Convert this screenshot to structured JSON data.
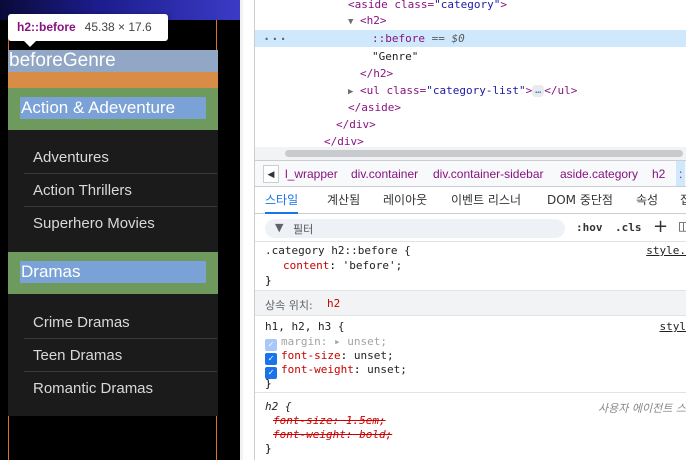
{
  "preview": {
    "before_text": "beforeGenre",
    "categories": [
      {
        "label": "Action & Adeventure",
        "items": [
          "Adventures",
          "Action Thrillers",
          "Superhero Movies"
        ]
      },
      {
        "label": "Dramas",
        "items": [
          "Crime Dramas",
          "Teen Dramas",
          "Romantic Dramas"
        ]
      }
    ]
  },
  "tooltip": {
    "name": "h2::before",
    "size": "45.38 × 17.6"
  },
  "dom": {
    "l0": {
      "tag": "<aside class=",
      "val": "\"category\"",
      "end": ">"
    },
    "l1": "<h2>",
    "l2": {
      "pseudo": "::before",
      "eq": "== $0"
    },
    "l3": "\"Genre\"",
    "l4": "</h2>",
    "l5": {
      "tag": "<ul class=",
      "val": "\"category-list\"",
      "end": ">",
      "dots": "…",
      "close": "</ul>"
    },
    "l6": "</aside>",
    "l7": "</div>",
    "l8": "</div>",
    "ellipsis": "···"
  },
  "crumbs": [
    "l_wrapper",
    "div.container",
    "div.container-sidebar",
    "aside.category",
    "h2",
    ":"
  ],
  "tabs": [
    "스타일",
    "계산됨",
    "레이아웃",
    "이벤트 리스너",
    "DOM 중단점",
    "속성",
    "접"
  ],
  "filter": {
    "placeholder": "필터",
    "hov": ":hov",
    "cls": ".cls",
    "plus": "+"
  },
  "rules": {
    "r1": {
      "selector": ".category h2::before {",
      "prop": "content",
      "val": "'before';",
      "close": "}",
      "source": "style."
    },
    "inherit": {
      "label": "상속 위치:",
      "tag": "h2"
    },
    "r2": {
      "selector": "h1, h2, h3 {",
      "source": "styl",
      "p1": "margin",
      "v1": "▸ unset;",
      "p2": "font-size",
      "v2": "unset;",
      "p3": "font-weight",
      "v3": "unset;",
      "close": "}"
    },
    "r3": {
      "selector": "h2 {",
      "ua": "사용자 에이전트 스",
      "p1": "font-size: 1.5em;",
      "p2": "font-weight: bold;",
      "close": "}"
    }
  }
}
